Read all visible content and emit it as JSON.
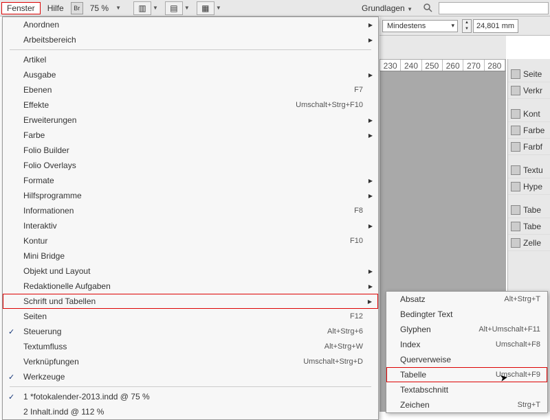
{
  "menubar": {
    "fenster": "Fenster",
    "hilfe": "Hilfe",
    "br": "Br",
    "zoom": "75 %",
    "grundlagen": "Grundlagen"
  },
  "ctrl": {
    "combo": "Mindestens",
    "stepper": "24,801 mm"
  },
  "ruler": [
    "230",
    "240",
    "250",
    "260",
    "270",
    "280"
  ],
  "menu": {
    "anordnen": "Anordnen",
    "arbeitsbereich": "Arbeitsbereich",
    "artikel": "Artikel",
    "ausgabe": "Ausgabe",
    "ebenen": "Ebenen",
    "ebenen_sc": "F7",
    "effekte": "Effekte",
    "effekte_sc": "Umschalt+Strg+F10",
    "erweiterungen": "Erweiterungen",
    "farbe": "Farbe",
    "foliobuilder": "Folio Builder",
    "foliooverlays": "Folio Overlays",
    "formate": "Formate",
    "hilfsprog": "Hilfsprogramme",
    "info": "Informationen",
    "info_sc": "F8",
    "interaktiv": "Interaktiv",
    "kontur": "Kontur",
    "kontur_sc": "F10",
    "minibridge": "Mini Bridge",
    "objlayout": "Objekt und Layout",
    "redaktion": "Redaktionelle Aufgaben",
    "schrift": "Schrift und Tabellen",
    "seiten": "Seiten",
    "seiten_sc": "F12",
    "steuerung": "Steuerung",
    "steuerung_sc": "Alt+Strg+6",
    "textfluss": "Textumfluss",
    "textfluss_sc": "Alt+Strg+W",
    "verkn": "Verknüpfungen",
    "verkn_sc": "Umschalt+Strg+D",
    "werkzeuge": "Werkzeuge",
    "doc1": "1 *fotokalender-2013.indd @ 75 %",
    "doc2": "2 Inhalt.indd @ 112 %"
  },
  "submenu": {
    "absatz": "Absatz",
    "absatz_sc": "Alt+Strg+T",
    "bedingter": "Bedingter Text",
    "glyphen": "Glyphen",
    "glyphen_sc": "Alt+Umschalt+F11",
    "index": "Index",
    "index_sc": "Umschalt+F8",
    "querverweise": "Querverweise",
    "tabelle": "Tabelle",
    "tabelle_sc": "Umschalt+F9",
    "textabschnitt": "Textabschnitt",
    "zeichen": "Zeichen",
    "zeichen_sc": "Strg+T"
  },
  "panels": {
    "seiten": "Seite",
    "verk": "Verkr",
    "kontur": "Kont",
    "farbe": "Farbe",
    "farbf": "Farbf",
    "text": "Textu",
    "hyper": "Hype",
    "tabelle1": "Tabe",
    "tabelle2": "Tabe",
    "zellen": "Zelle"
  }
}
